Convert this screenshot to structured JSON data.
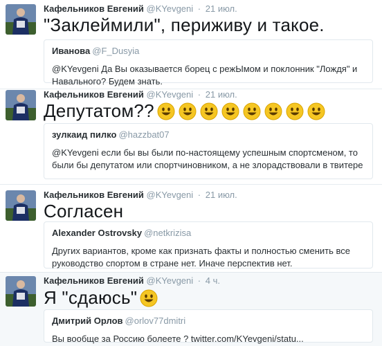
{
  "colors": {
    "name": "#292f33",
    "muted": "#8899a6",
    "border": "#e1e8ed",
    "highlight_bg": "#f5f8fa",
    "emoji": "#f5c623"
  },
  "icons": {
    "avatar": "user-avatar-image",
    "emoji": "smiling-face-emoji"
  },
  "tweets": [
    {
      "author": "Кафельников Евгений",
      "handle": "@KYevgeni",
      "sep": "·",
      "time": "21 июл.",
      "text": "\"Заклеймили\", периживу и такое.",
      "emoji_count": 0,
      "quote": {
        "name": "Иванова",
        "handle": "@F_Dusyia",
        "text": "@KYevgeni Да Вы оказывается борец с режЫмом и поклонник \"Лождя\" и Навального? Будем знать."
      }
    },
    {
      "author": "Кафельников Евгений",
      "handle": "@KYevgeni",
      "sep": "·",
      "time": "21 июл.",
      "text": "Депутатом??",
      "emoji_count": 8,
      "quote": {
        "name": "зулкаид пилко",
        "handle": "@hazzbat07",
        "text": "@KYevgeni если бы вы были по-настоящему успешным спортсменом, то были бы депутатом или спортчиновником, а не злорадствовали в твитере"
      }
    },
    {
      "author": "Кафельников Евгений",
      "handle": "@KYevgeni",
      "sep": "·",
      "time": "21 июл.",
      "text": "Согласен",
      "emoji_count": 0,
      "quote": {
        "name": "Alexander Ostrovsky",
        "handle": "@netkrizisa",
        "text": "Других вариантов, кроме как признать факты и полностью сменить все руководство спортом в стране нет. Иначе перспектив нет."
      }
    },
    {
      "author": "Кафельников Евгений",
      "handle": "@KYevgeni",
      "sep": "·",
      "time": "4 ч.",
      "text": "Я \"сдаюсь\"",
      "emoji_count": 1,
      "quote": {
        "name": "Дмитрий Орлов",
        "handle": "@orlov77dmitri",
        "text": "Вы вообще за Россию болеете ? twitter.com/KYevgeni/statu..."
      }
    }
  ]
}
